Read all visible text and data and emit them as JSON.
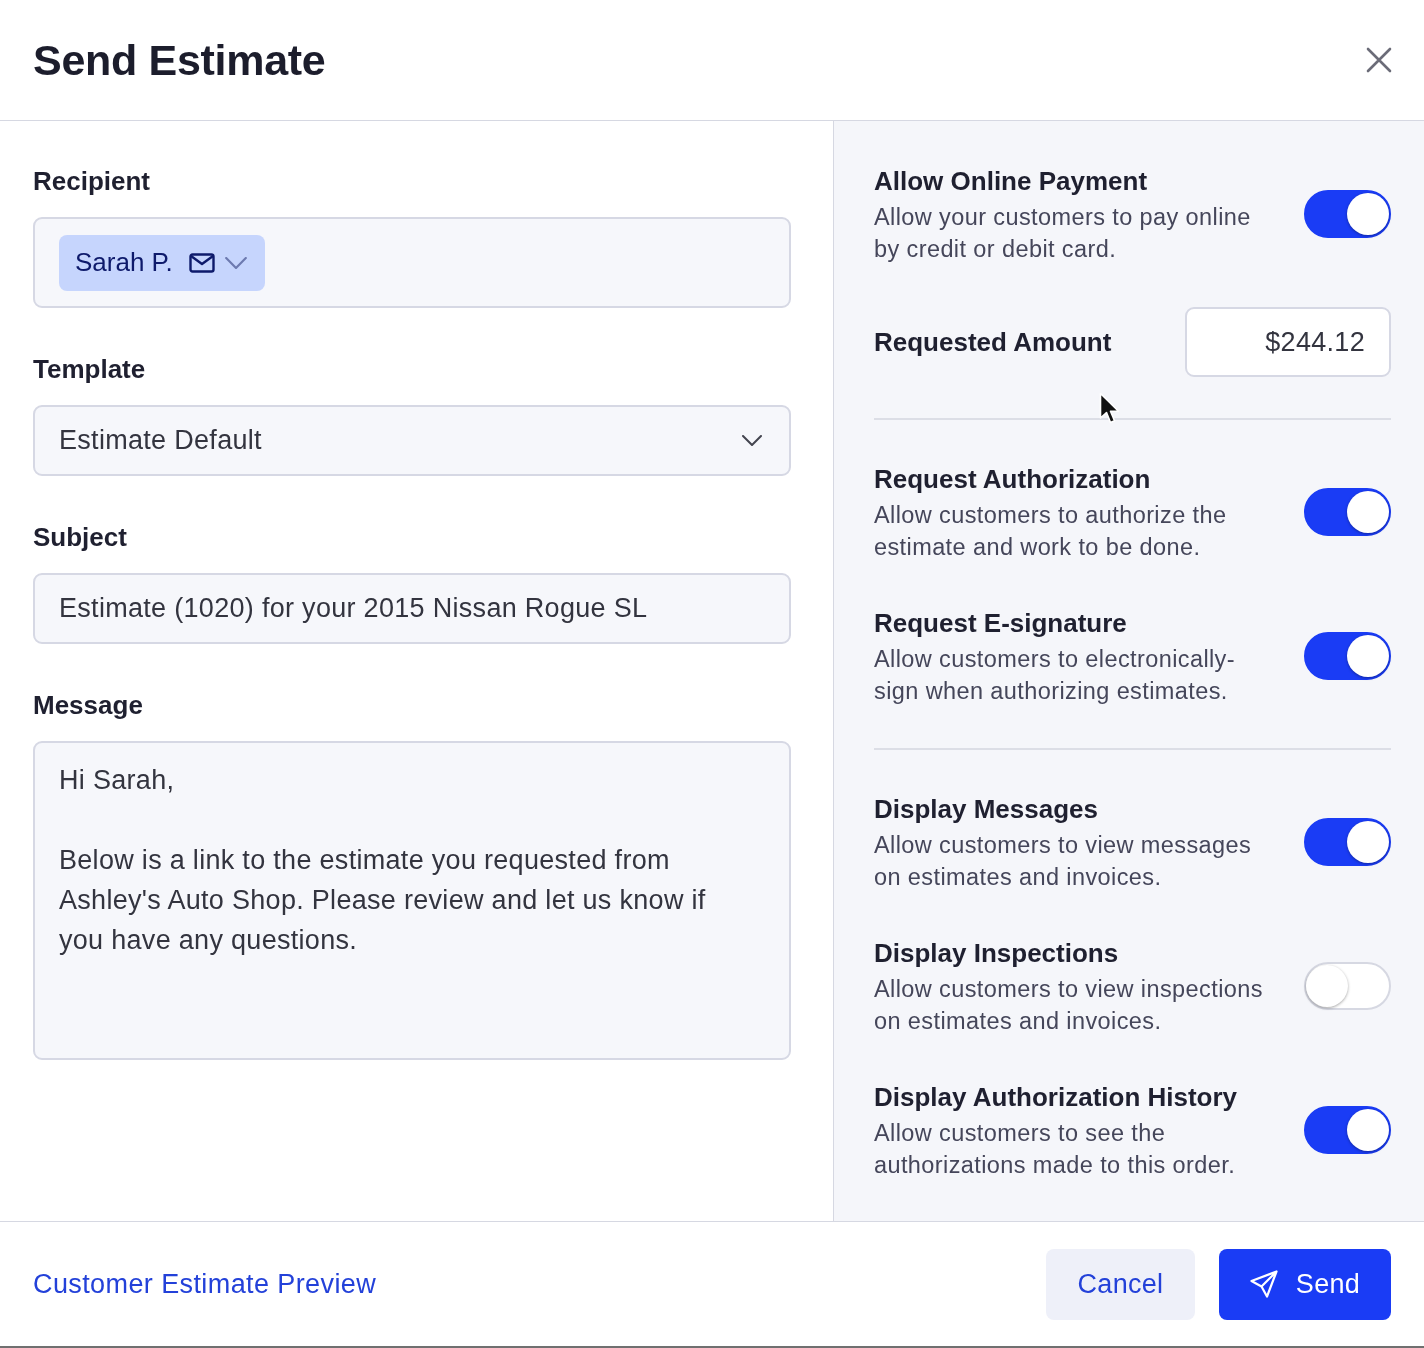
{
  "dialog": {
    "title": "Send Estimate"
  },
  "form": {
    "recipient": {
      "label": "Recipient",
      "chips": [
        {
          "name": "Sarah P."
        }
      ]
    },
    "template": {
      "label": "Template",
      "value": "Estimate Default"
    },
    "subject": {
      "label": "Subject",
      "value": "Estimate (1020) for your 2015 Nissan Rogue SL"
    },
    "message": {
      "label": "Message",
      "value": "Hi Sarah,\n\nBelow is a link to the estimate you requested from Ashley's Auto Shop. Please review and let us know if you have any questions."
    }
  },
  "settings": {
    "groups": [
      {
        "items": [
          {
            "kind": "toggle",
            "title": "Allow Online Payment",
            "description": "Allow your customers to pay online by credit or debit card.",
            "on": true
          },
          {
            "kind": "amount",
            "label": "Requested Amount",
            "value": "$244.12"
          }
        ]
      },
      {
        "items": [
          {
            "kind": "toggle",
            "title": "Request Authorization",
            "description": "Allow customers to authorize the estimate and work to be done.",
            "on": true
          },
          {
            "kind": "toggle",
            "title": "Request E-signature",
            "description": "Allow customers to electronically-sign when authorizing estimates.",
            "on": true
          }
        ]
      },
      {
        "items": [
          {
            "kind": "toggle",
            "title": "Display Messages",
            "description": "Allow customers to view messages on estimates and invoices.",
            "on": true
          },
          {
            "kind": "toggle",
            "title": "Display Inspections",
            "description": "Allow customers to view inspections on estimates and invoices.",
            "on": false
          },
          {
            "kind": "toggle",
            "title": "Display Authorization History",
            "description": "Allow customers to see the authorizations made to this order.",
            "on": true
          }
        ]
      }
    ]
  },
  "footer": {
    "link": "Customer Estimate Preview",
    "buttons": [
      {
        "kind": "secondary",
        "label": "Cancel"
      },
      {
        "kind": "primary",
        "label": "Send"
      }
    ]
  }
}
